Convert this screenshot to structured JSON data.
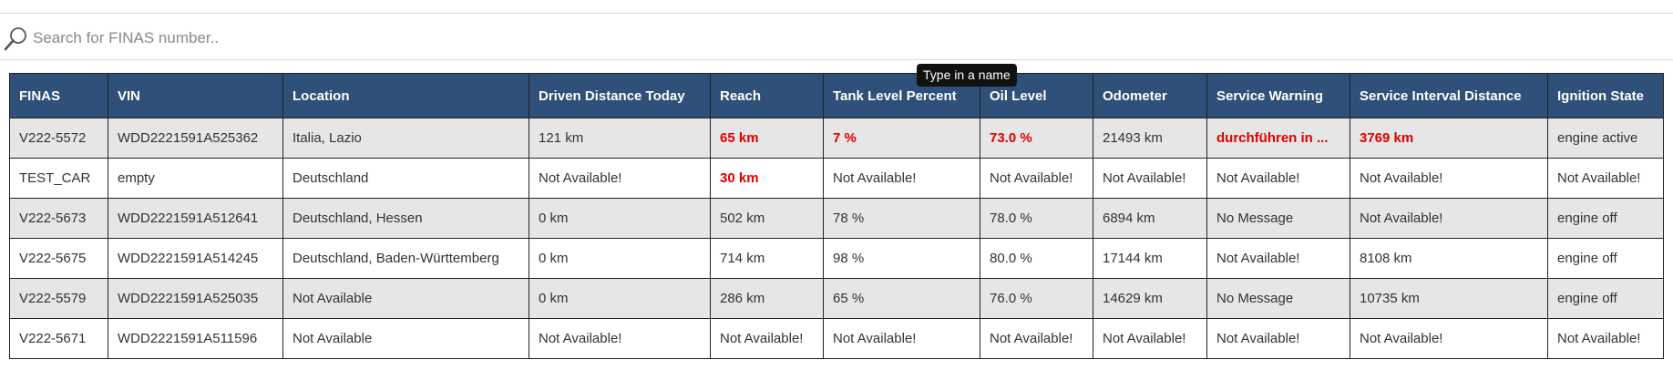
{
  "search": {
    "placeholder": "Search for FINAS number..",
    "value": ""
  },
  "tooltip": {
    "text": "Type in a name"
  },
  "colors": {
    "header_bg": "#2f5079",
    "alert": "#e00000",
    "row_shaded": "#e6e6e6"
  },
  "table": {
    "columns": [
      "FINAS",
      "VIN",
      "Location",
      "Driven Distance Today",
      "Reach",
      "Tank Level Percent",
      "Oil Level",
      "Odometer",
      "Service Warning",
      "Service Interval Distance",
      "Ignition State"
    ],
    "rows": [
      {
        "cells": [
          "V222-5572",
          "WDD2221591A525362",
          "Italia, Lazio",
          "121 km",
          "65 km",
          "7 %",
          "73.0 %",
          "21493 km",
          "durchführen in ...",
          "3769 km",
          "engine active"
        ],
        "alerts": [
          4,
          5,
          6,
          8,
          9
        ]
      },
      {
        "cells": [
          "TEST_CAR",
          "empty",
          "Deutschland",
          "Not Available!",
          "30 km",
          "Not Available!",
          "Not Available!",
          "Not Available!",
          "Not Available!",
          "Not Available!",
          "Not Available!"
        ],
        "alerts": [
          4
        ]
      },
      {
        "cells": [
          "V222-5673",
          "WDD2221591A512641",
          "Deutschland, Hessen",
          "0 km",
          "502 km",
          "78 %",
          "78.0 %",
          "6894 km",
          "No Message",
          "Not Available!",
          "engine off"
        ],
        "alerts": []
      },
      {
        "cells": [
          "V222-5675",
          "WDD2221591A514245",
          "Deutschland, Baden-Württemberg",
          "0 km",
          "714 km",
          "98 %",
          "80.0 %",
          "17144 km",
          "Not Available!",
          "8108 km",
          "engine off"
        ],
        "alerts": []
      },
      {
        "cells": [
          "V222-5579",
          "WDD2221591A525035",
          "Not Available",
          "0 km",
          "286 km",
          "65 %",
          "76.0 %",
          "14629 km",
          "No Message",
          "10735 km",
          "engine off"
        ],
        "alerts": []
      },
      {
        "cells": [
          "V222-5671",
          "WDD2221591A511596",
          "Not Available",
          "Not Available!",
          "Not Available!",
          "Not Available!",
          "Not Available!",
          "Not Available!",
          "Not Available!",
          "Not Available!",
          "Not Available!"
        ],
        "alerts": []
      }
    ]
  }
}
